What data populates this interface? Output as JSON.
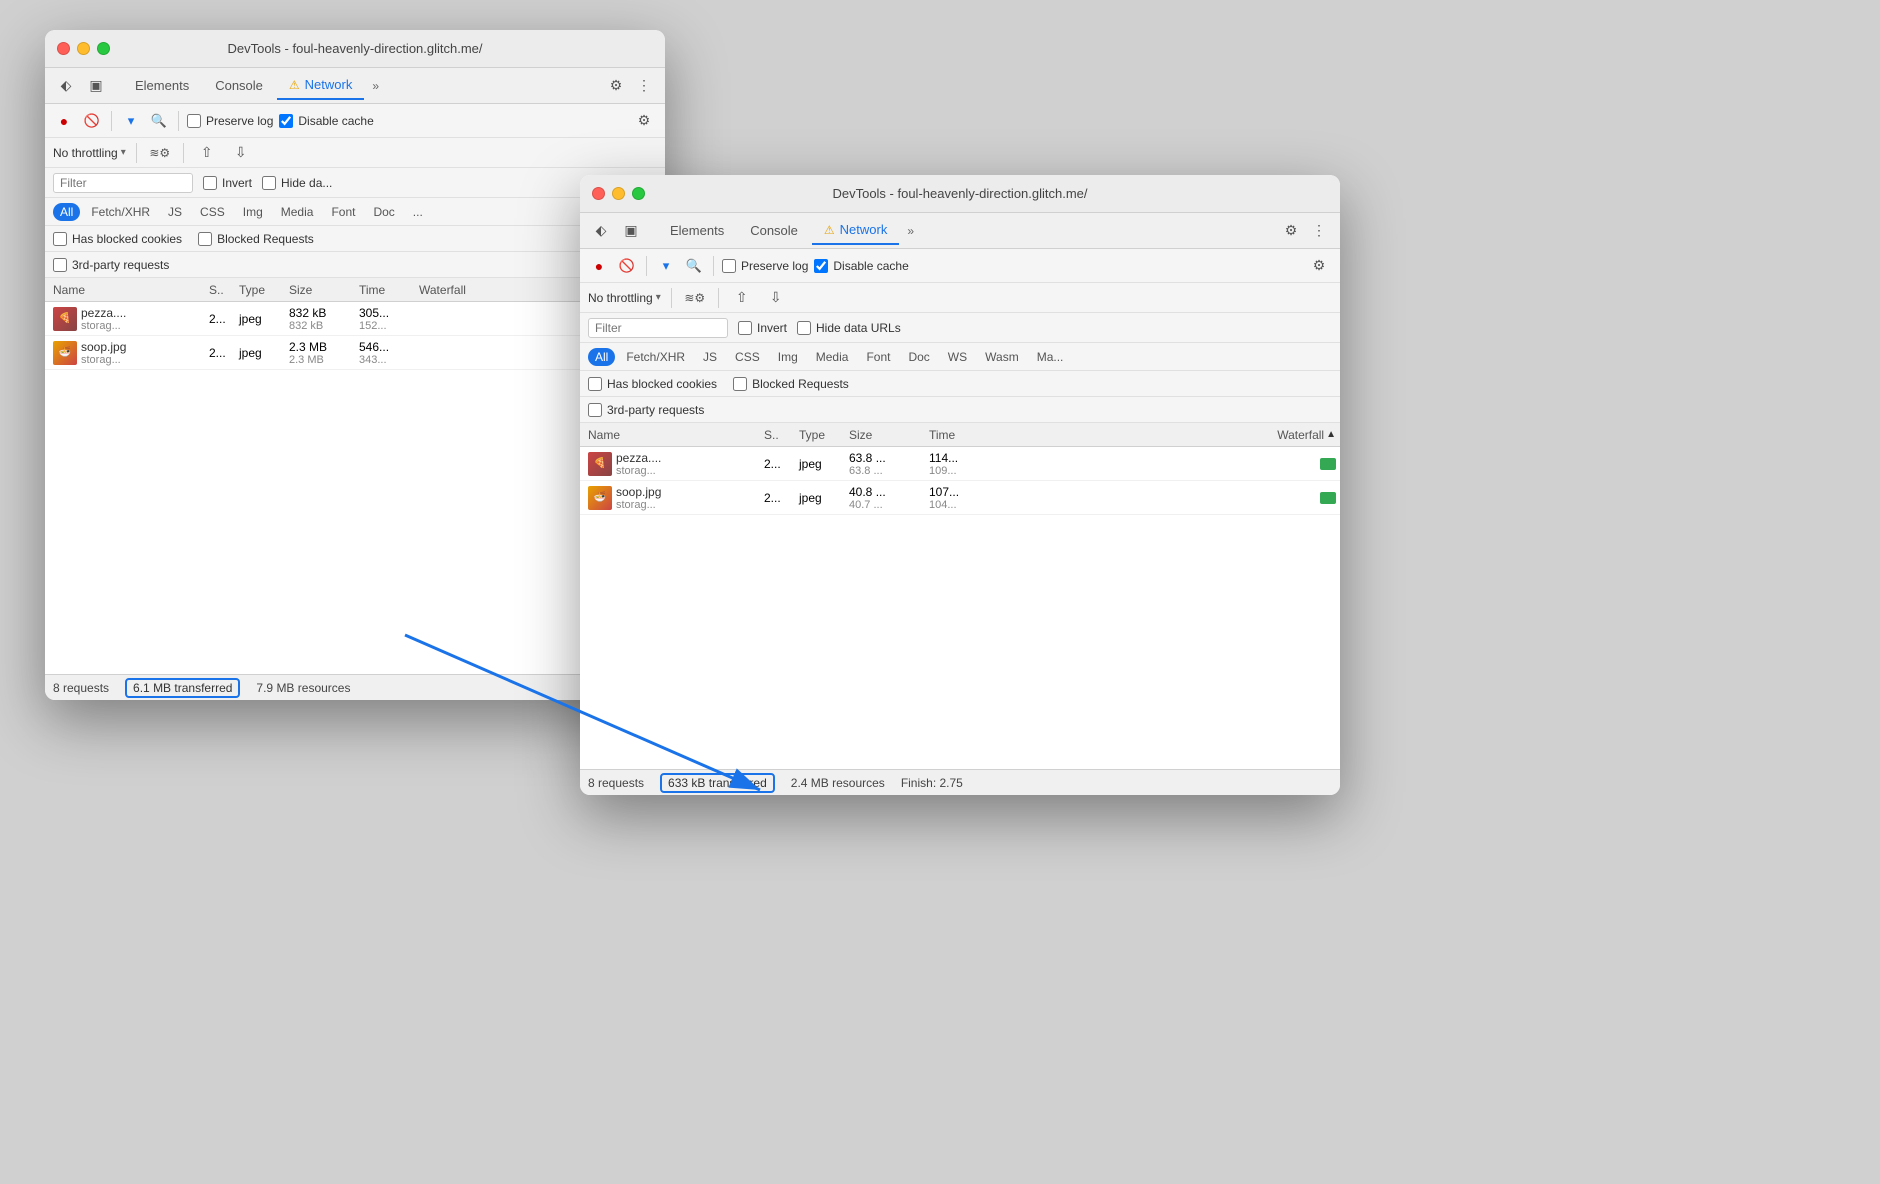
{
  "window1": {
    "title": "DevTools - foul-heavenly-direction.glitch.me/",
    "tabs": [
      {
        "label": "Elements",
        "active": false
      },
      {
        "label": "Console",
        "active": false
      },
      {
        "label": "Network",
        "active": true,
        "warning": true
      },
      {
        "label": "»",
        "more": true
      }
    ],
    "toolbar": {
      "record_label": "●",
      "stop_label": "🚫",
      "filter_label": "▾",
      "search_label": "🔍",
      "preserve_log": "Preserve log",
      "disable_cache": "Disable cache",
      "preserve_checked": false,
      "disable_checked": true
    },
    "throttle": {
      "label": "No throttling",
      "wifi_label": "≈"
    },
    "filter": {
      "placeholder": "Filter",
      "invert_label": "Invert",
      "hide_data_label": "Hide da..."
    },
    "type_filters": [
      "All",
      "Fetch/XHR",
      "JS",
      "CSS",
      "Img",
      "Media",
      "Font",
      "Doc"
    ],
    "checkbox_filters": {
      "has_blocked": "Has blocked cookies",
      "blocked_requests": "Blocked Requests",
      "third_party": "3rd-party requests"
    },
    "table": {
      "headers": [
        "Name",
        "S..",
        "Type",
        "Size",
        "Time",
        "Waterfall"
      ],
      "rows": [
        {
          "name": "pezza....",
          "sub": "storag...",
          "s": "2...",
          "type": "jpeg",
          "size": "832 kB",
          "size2": "832 kB",
          "time": "305...",
          "time2": "152..."
        },
        {
          "name": "soop.jpg",
          "sub": "storag...",
          "s": "2...",
          "type": "jpeg",
          "size": "2.3 MB",
          "size2": "2.3 MB",
          "time": "546...",
          "time2": "343..."
        }
      ]
    },
    "status_bar": {
      "requests": "8 requests",
      "transferred": "6.1 MB transferred",
      "resources": "7.9 MB resources"
    }
  },
  "window2": {
    "title": "DevTools - foul-heavenly-direction.glitch.me/",
    "tabs": [
      {
        "label": "Elements",
        "active": false
      },
      {
        "label": "Console",
        "active": false
      },
      {
        "label": "Network",
        "active": true,
        "warning": true
      },
      {
        "label": "»",
        "more": true
      }
    ],
    "toolbar": {
      "record_label": "●",
      "stop_label": "🚫",
      "filter_label": "▾",
      "search_label": "🔍",
      "preserve_log": "Preserve log",
      "disable_cache": "Disable cache",
      "preserve_checked": false,
      "disable_checked": true
    },
    "throttle": {
      "label": "No throttling"
    },
    "filter": {
      "placeholder": "Filter",
      "invert_label": "Invert",
      "hide_data_label": "Hide data URLs"
    },
    "type_filters": [
      "All",
      "Fetch/XHR",
      "JS",
      "CSS",
      "Img",
      "Media",
      "Font",
      "Doc",
      "WS",
      "Wasm",
      "Ma..."
    ],
    "checkbox_filters": {
      "has_blocked": "Has blocked cookies",
      "blocked_requests": "Blocked Requests",
      "third_party": "3rd-party requests"
    },
    "table": {
      "headers": [
        "Name",
        "S..",
        "Type",
        "Size",
        "Time",
        "Waterfall"
      ],
      "rows": [
        {
          "name": "pezza....",
          "sub": "storag...",
          "s": "2...",
          "type": "jpeg",
          "size": "63.8 ...",
          "size2": "63.8 ...",
          "time": "114...",
          "time2": "109..."
        },
        {
          "name": "soop.jpg",
          "sub": "storag...",
          "s": "2...",
          "type": "jpeg",
          "size": "40.8 ...",
          "size2": "40.7 ...",
          "time": "107...",
          "time2": "104..."
        }
      ]
    },
    "status_bar": {
      "requests": "8 requests",
      "transferred": "633 kB transferred",
      "resources": "2.4 MB resources",
      "finish": "Finish: 2.75"
    }
  },
  "arrow": {
    "label": "→"
  }
}
